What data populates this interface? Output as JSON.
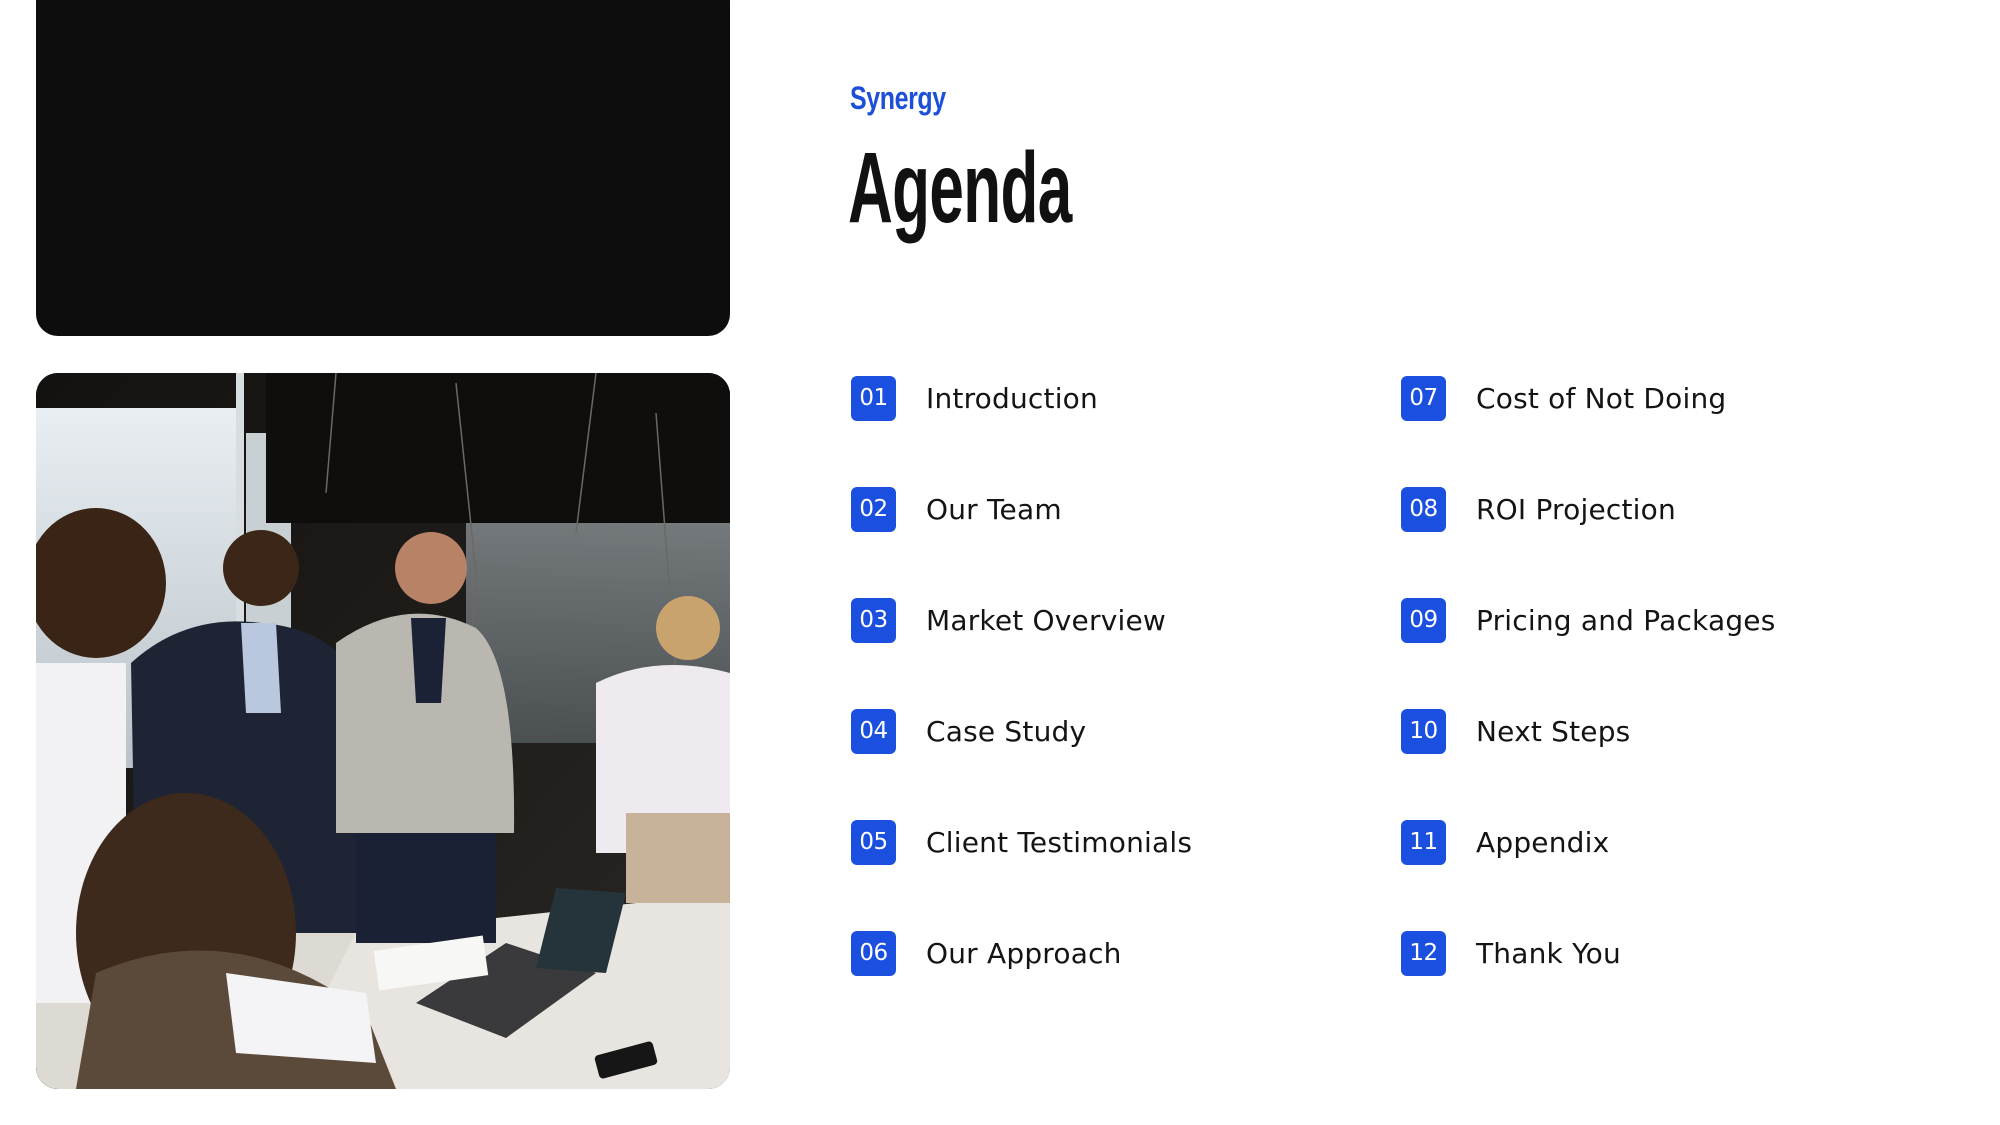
{
  "slide": {
    "eyebrow": "Synergy",
    "title": "Agenda",
    "accent_color": "#1a4fe0"
  },
  "images": {
    "photo": "business-team-meeting-photo"
  },
  "agenda": {
    "items": [
      {
        "number": "01",
        "label": "Introduction"
      },
      {
        "number": "02",
        "label": "Our Team"
      },
      {
        "number": "03",
        "label": "Market Overview"
      },
      {
        "number": "04",
        "label": "Case Study"
      },
      {
        "number": "05",
        "label": "Client Testimonials"
      },
      {
        "number": "06",
        "label": "Our Approach"
      },
      {
        "number": "07",
        "label": "Cost of Not Doing"
      },
      {
        "number": "08",
        "label": "ROI Projection"
      },
      {
        "number": "09",
        "label": "Pricing and Packages"
      },
      {
        "number": "10",
        "label": "Next Steps"
      },
      {
        "number": "11",
        "label": "Appendix"
      },
      {
        "number": "12",
        "label": "Thank You"
      }
    ]
  }
}
